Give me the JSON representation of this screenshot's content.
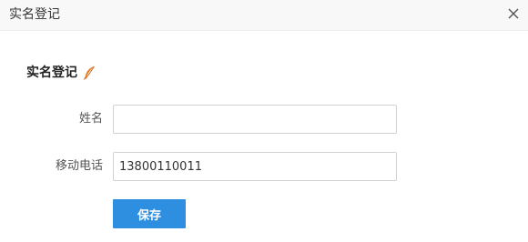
{
  "dialog": {
    "title": "实名登记",
    "close_icon": "close-icon"
  },
  "section": {
    "title": "实名登记",
    "icon": "feather-icon",
    "icon_color": "#f07b1e"
  },
  "form": {
    "name": {
      "label": "姓名",
      "value": ""
    },
    "phone": {
      "label": "移动电话",
      "value": "13800110011"
    }
  },
  "actions": {
    "save_label": "保存",
    "save_color": "#2e8fe0"
  }
}
